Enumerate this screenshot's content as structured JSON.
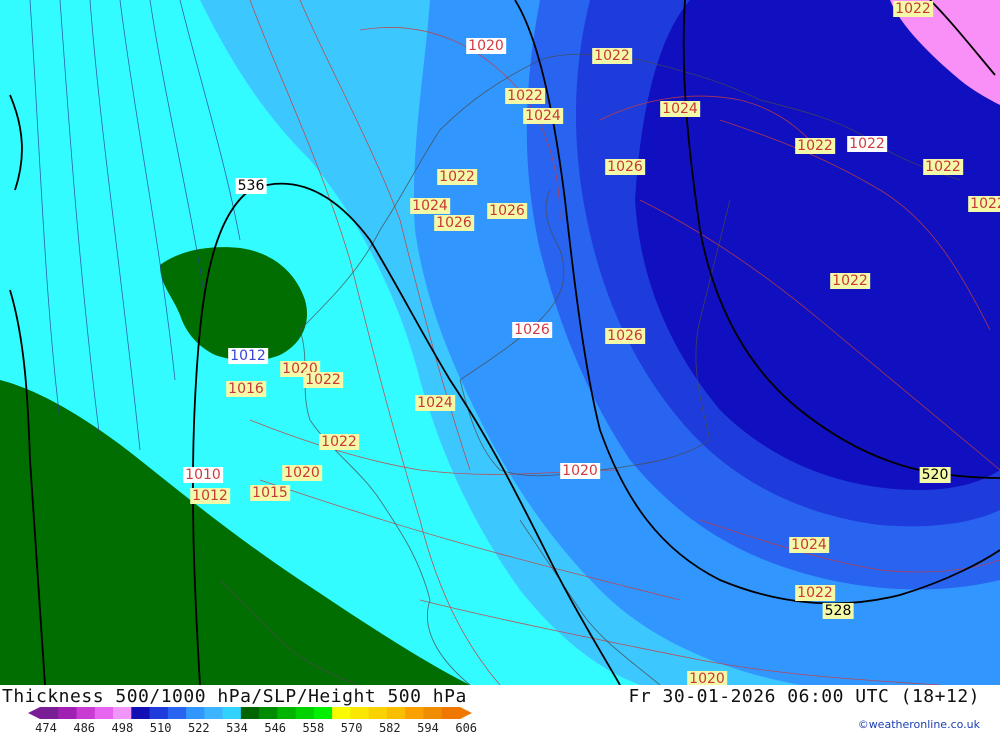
{
  "map": {
    "slp_labels": [
      {
        "text": "1020",
        "style": "w"
      },
      {
        "text": "1022",
        "style": "y"
      },
      {
        "text": "1022",
        "style": "y"
      },
      {
        "text": "1024",
        "style": "y"
      },
      {
        "text": "1024",
        "style": "y"
      },
      {
        "text": "1026",
        "style": "y"
      },
      {
        "text": "1022",
        "style": "y"
      },
      {
        "text": "1022",
        "style": "w"
      },
      {
        "text": "1022",
        "style": "y"
      },
      {
        "text": "1022",
        "style": "y"
      },
      {
        "text": "1024",
        "style": "y"
      },
      {
        "text": "1026",
        "style": "y"
      },
      {
        "text": "1026",
        "style": "y"
      },
      {
        "text": "1022",
        "style": "y"
      },
      {
        "text": "1026",
        "style": "w"
      },
      {
        "text": "1026",
        "style": "y"
      },
      {
        "text": "1012",
        "style": "b"
      },
      {
        "text": "1020",
        "style": "y"
      },
      {
        "text": "1022",
        "style": "y"
      },
      {
        "text": "1016",
        "style": "y"
      },
      {
        "text": "1024",
        "style": "y"
      },
      {
        "text": "1022",
        "style": "y"
      },
      {
        "text": "1020",
        "style": "y"
      },
      {
        "text": "1020",
        "style": "w"
      },
      {
        "text": "1010",
        "style": "w"
      },
      {
        "text": "1012",
        "style": "y"
      },
      {
        "text": "1015",
        "style": "y"
      },
      {
        "text": "1024",
        "style": "y"
      },
      {
        "text": "1022",
        "style": "y"
      },
      {
        "text": "1020",
        "style": "y"
      },
      {
        "text": "1022",
        "style": "y"
      },
      {
        "text": "1022",
        "style": "y"
      }
    ],
    "height_labels": [
      {
        "text": "536",
        "style": "h"
      },
      {
        "text": "520",
        "style": "hy"
      },
      {
        "text": "528",
        "style": "hy"
      }
    ]
  },
  "footer": {
    "title": "Thickness 500/1000 hPa/SLP/Height 500 hPa",
    "valid_time": "Fr 30-01-2026 06:00 UTC (18+12)",
    "credit": "©weatheronline.co.uk"
  },
  "legend": {
    "ticks": [
      "474",
      "486",
      "498",
      "510",
      "522",
      "534",
      "546",
      "558",
      "570",
      "582",
      "594",
      "606"
    ],
    "colors": [
      "#7a1e96",
      "#a020b4",
      "#c83cd2",
      "#e664f0",
      "#f096f8",
      "#1010b4",
      "#1e3cdc",
      "#2864f0",
      "#3296ff",
      "#3cb4ff",
      "#32d2ff",
      "#006400",
      "#008c00",
      "#00b400",
      "#00d200",
      "#00f000",
      "#fafa00",
      "#fae600",
      "#fad200",
      "#fabe00",
      "#faa000",
      "#f08c00",
      "#f07800"
    ]
  },
  "colors": {
    "thick_522": "#3cc8ff",
    "thick_516": "#3296ff",
    "thick_510": "#2864f0",
    "thick_504": "#1e3cdc",
    "thick_498": "#1010c0",
    "thick_528": "#32fcff",
    "thick_534": "#006e00",
    "thick_low": "#f890f8",
    "isobar": "#c83c3c",
    "height": "#000000",
    "coast": "#555555"
  }
}
